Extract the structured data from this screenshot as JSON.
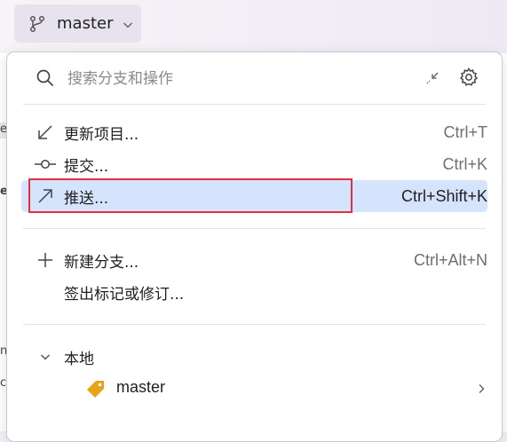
{
  "branch_widget": {
    "label": "master"
  },
  "search": {
    "placeholder": "搜索分支和操作"
  },
  "actions": [
    {
      "icon": "update-arrow-icon",
      "label": "更新项目...",
      "shortcut": "Ctrl+T"
    },
    {
      "icon": "commit-icon",
      "label": "提交...",
      "shortcut": "Ctrl+K"
    },
    {
      "icon": "push-arrow-icon",
      "label": "推送...",
      "shortcut": "Ctrl+Shift+K",
      "selected": true
    }
  ],
  "actions2": [
    {
      "icon": "plus-icon",
      "label": "新建分支...",
      "shortcut": "Ctrl+Alt+N"
    },
    {
      "icon": "",
      "label": "签出标记或修订...",
      "shortcut": ""
    }
  ],
  "local_section": {
    "label": "本地"
  },
  "local_branches": [
    {
      "name": "master",
      "icon": "tag-icon"
    }
  ],
  "background": {
    "fragment_a": "e",
    "fragment_b": "e",
    "fragment_c": "n.",
    "fragment_d": "c"
  },
  "colors": {
    "selection": "#d6e3fd",
    "highlight_border": "#e0303c",
    "tag": "#e8a317"
  }
}
